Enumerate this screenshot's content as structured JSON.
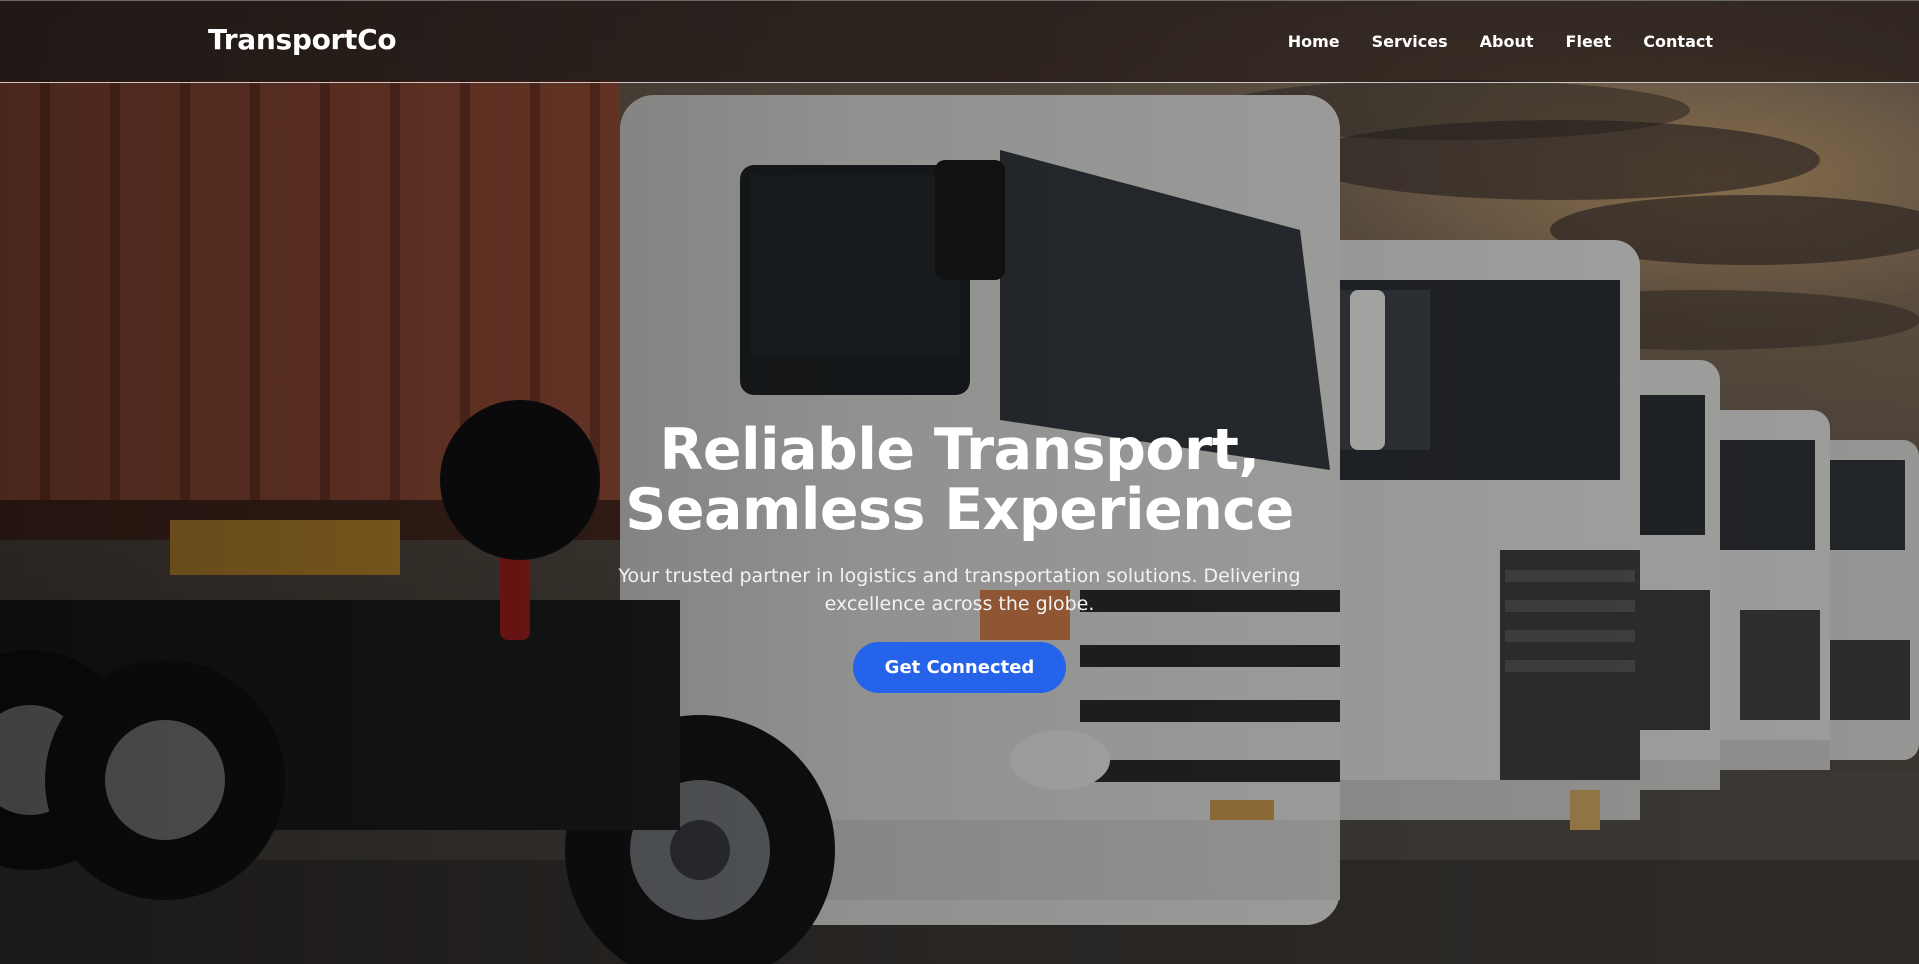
{
  "nav": {
    "brand": "TransportCo",
    "links": [
      {
        "label": "Home"
      },
      {
        "label": "Services"
      },
      {
        "label": "About"
      },
      {
        "label": "Fleet"
      },
      {
        "label": "Contact"
      }
    ]
  },
  "hero": {
    "title_line_1": "Reliable Transport,",
    "title_line_2": "Seamless Experience",
    "subtitle": "Your trusted partner in logistics and transportation solutions. Delivering excellence across the globe.",
    "cta_label": "Get Connected",
    "background_image": "fleet-of-white-trucks-photo"
  },
  "colors": {
    "accent": "#2563eb",
    "text": "#ffffff",
    "nav_background": "#140a0a"
  }
}
